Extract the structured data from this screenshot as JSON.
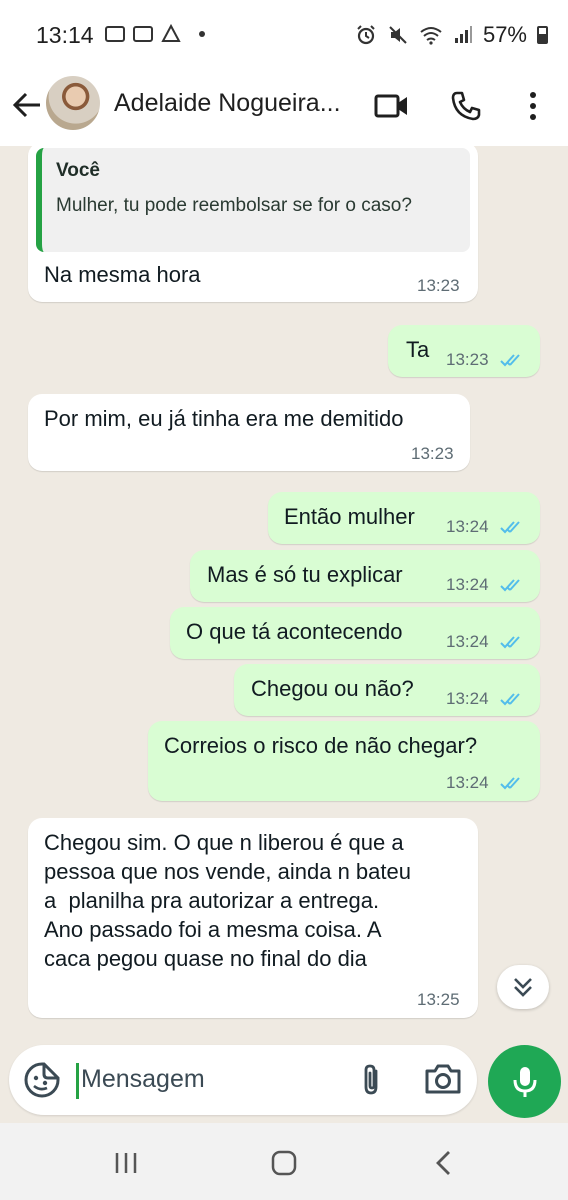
{
  "status_bar": {
    "time": "13:14",
    "battery": "57%",
    "battery_level": 0.57
  },
  "header": {
    "contact_name": "Adelaide Nogueira..."
  },
  "messages": [
    {
      "direction": "in",
      "quote_author": "Você",
      "quote_text": "Mulher, tu pode reembolsar se for o caso?",
      "text": "Na mesma hora",
      "time": "13:23"
    },
    {
      "direction": "out",
      "text": "Ta",
      "time": "13:23",
      "status": "read"
    },
    {
      "direction": "in",
      "text": "Por mim, eu já tinha era me demitido",
      "time": "13:23"
    },
    {
      "direction": "out",
      "text": "Então mulher",
      "time": "13:24",
      "status": "read"
    },
    {
      "direction": "out",
      "text": "Mas é só tu explicar",
      "time": "13:24",
      "status": "read"
    },
    {
      "direction": "out",
      "text": "O que tá acontecendo",
      "time": "13:24",
      "status": "read"
    },
    {
      "direction": "out",
      "text": "Chegou ou não?",
      "time": "13:24",
      "status": "read"
    },
    {
      "direction": "out",
      "text": "Correios o risco de não chegar?",
      "time": "13:24",
      "status": "read"
    },
    {
      "direction": "in",
      "text": "Chegou sim. O que n liberou é que a\npessoa que nos vende, ainda n bateu\na  planilha pra autorizar a entrega.\nAno passado foi a mesma coisa. A\ncaca pegou quase no final do dia",
      "time": "13:25"
    }
  ],
  "input": {
    "placeholder": "Mensagem"
  },
  "colors": {
    "outgoing_bubble": "#d9fdd3",
    "incoming_bubble": "#ffffff",
    "chat_background": "#efeae2",
    "accent_green": "#1fa855",
    "read_ticks": "#53bdeb"
  },
  "icons": [
    "back-arrow-icon",
    "video-call-icon",
    "phone-icon",
    "more-options-icon",
    "chevrons-down-icon",
    "sticker-icon",
    "paperclip-icon",
    "camera-icon",
    "mic-icon",
    "recent-apps-icon",
    "home-icon",
    "back-nav-icon"
  ]
}
